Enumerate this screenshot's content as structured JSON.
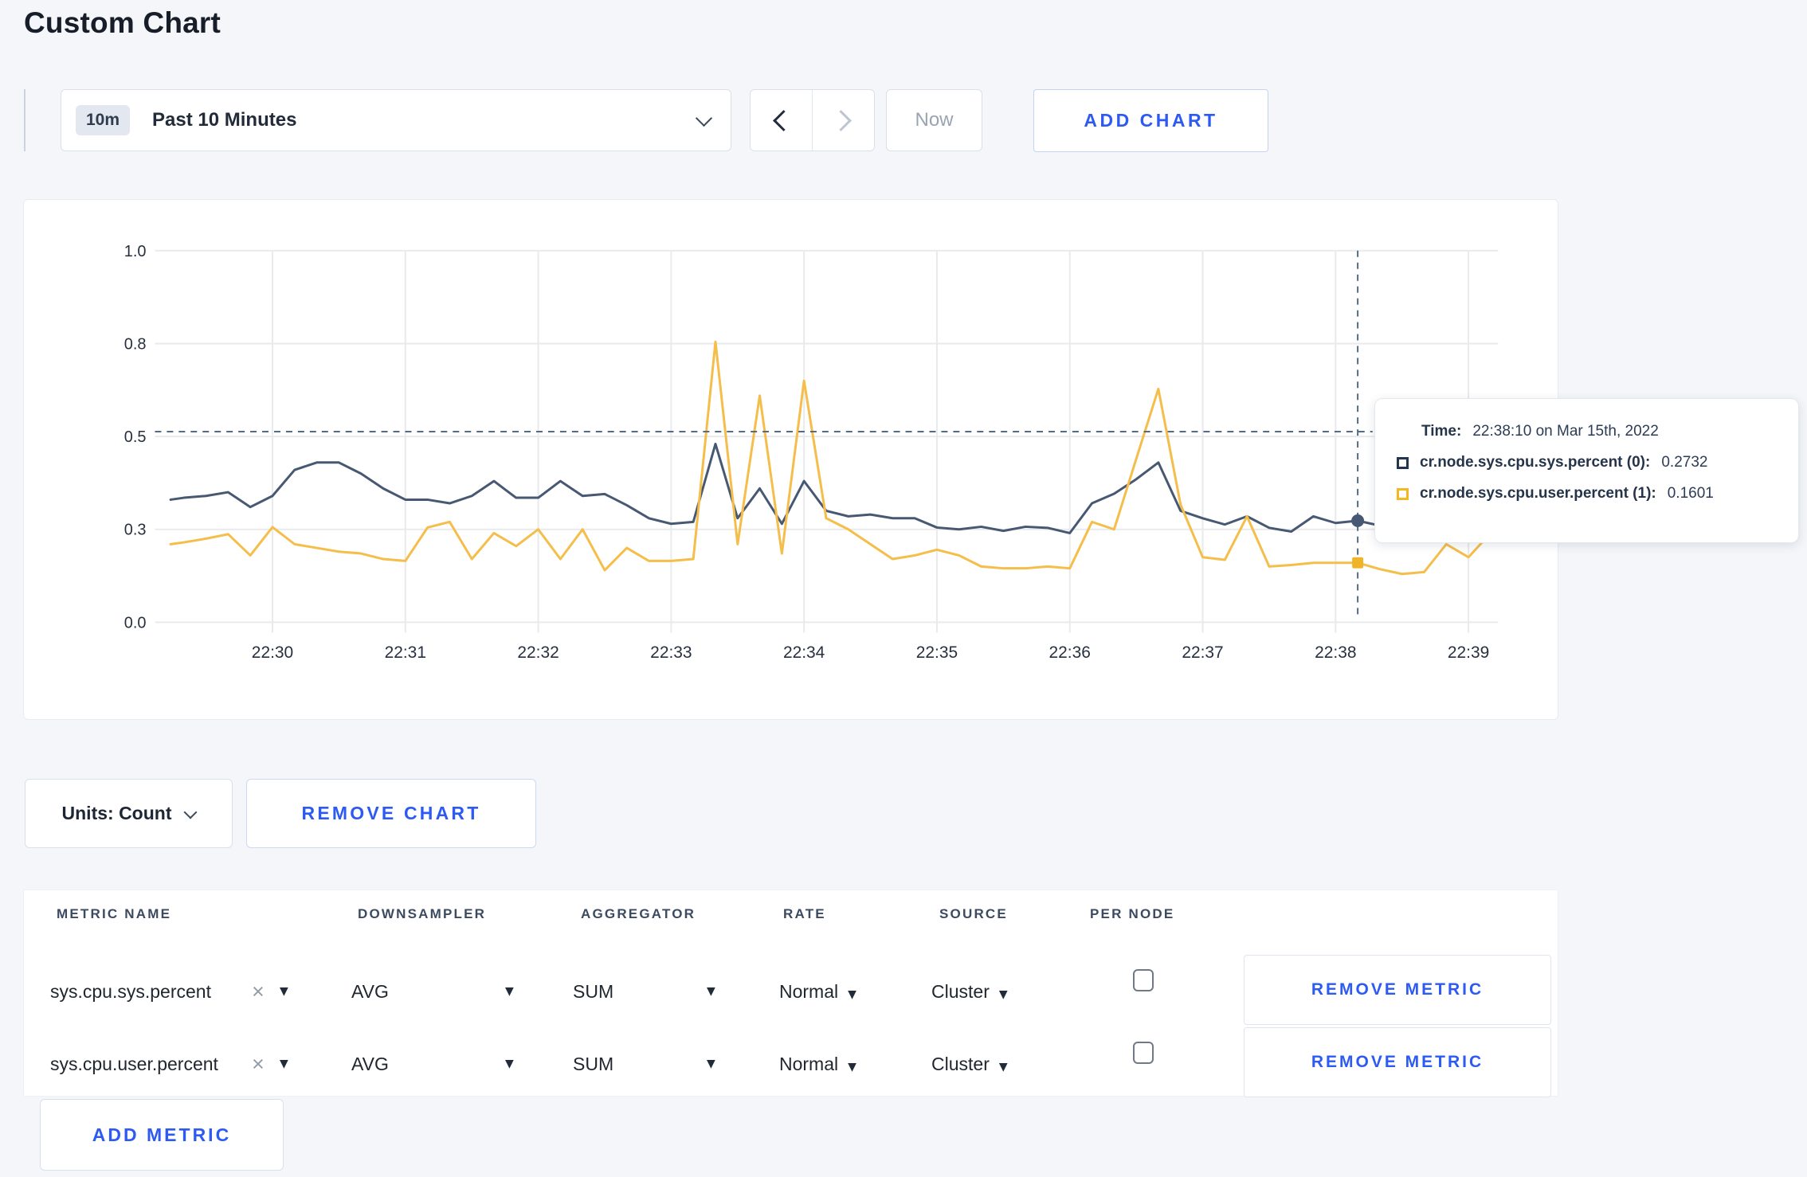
{
  "page": {
    "title": "Custom Chart"
  },
  "toolbar": {
    "range_badge": "10m",
    "range_label": "Past 10 Minutes",
    "now_label": "Now",
    "add_chart_label": "ADD CHART"
  },
  "chart_controls": {
    "units_label": "Units: Count",
    "remove_chart_label": "REMOVE CHART"
  },
  "tooltip": {
    "time_label": "Time:",
    "time_value": "22:38:10 on Mar 15th, 2022",
    "rows": [
      {
        "label": "cr.node.sys.cpu.sys.percent (0):",
        "value": "0.2732",
        "color": "#24344d"
      },
      {
        "label": "cr.node.sys.cpu.user.percent (1):",
        "value": "0.1601",
        "color": "#f3b822"
      }
    ]
  },
  "chart_data": {
    "type": "line",
    "title": "",
    "xlabel": "",
    "ylabel": "",
    "grid": true,
    "ylim": [
      0,
      1
    ],
    "y_tick_labels": [
      "1.0",
      "0.8",
      "0.5",
      "0.3",
      "0.0"
    ],
    "y_tick_values": [
      1.0,
      0.75,
      0.5,
      0.25,
      0.0
    ],
    "x_ticks": [
      "22:30",
      "22:31",
      "22:32",
      "22:33",
      "22:34",
      "22:35",
      "22:36",
      "22:37",
      "22:38",
      "22:39"
    ],
    "x_unit": "seconds after 22:29:00 on Mar 15th, 2022",
    "colors": {
      "grid": "#e9eaec",
      "axis_text": "#27303f",
      "crosshair": "#546b85"
    },
    "series": [
      {
        "name": "cr.node.sys.cpu.sys.percent",
        "color": "#475872",
        "points": [
          [
            14,
            0.33
          ],
          [
            20,
            0.335
          ],
          [
            30,
            0.34
          ],
          [
            40,
            0.35
          ],
          [
            50,
            0.31
          ],
          [
            60,
            0.34
          ],
          [
            70,
            0.41
          ],
          [
            80,
            0.43
          ],
          [
            90,
            0.43
          ],
          [
            100,
            0.4
          ],
          [
            110,
            0.36
          ],
          [
            120,
            0.33
          ],
          [
            130,
            0.33
          ],
          [
            140,
            0.32
          ],
          [
            150,
            0.34
          ],
          [
            160,
            0.38
          ],
          [
            170,
            0.335
          ],
          [
            180,
            0.335
          ],
          [
            190,
            0.38
          ],
          [
            200,
            0.34
          ],
          [
            210,
            0.345
          ],
          [
            220,
            0.315
          ],
          [
            230,
            0.28
          ],
          [
            240,
            0.265
          ],
          [
            250,
            0.27
          ],
          [
            260,
            0.48
          ],
          [
            270,
            0.28
          ],
          [
            280,
            0.36
          ],
          [
            290,
            0.265
          ],
          [
            300,
            0.38
          ],
          [
            310,
            0.3
          ],
          [
            320,
            0.285
          ],
          [
            330,
            0.29
          ],
          [
            340,
            0.28
          ],
          [
            350,
            0.28
          ],
          [
            360,
            0.255
          ],
          [
            370,
            0.25
          ],
          [
            380,
            0.257
          ],
          [
            390,
            0.246
          ],
          [
            400,
            0.257
          ],
          [
            410,
            0.254
          ],
          [
            420,
            0.24
          ],
          [
            430,
            0.32
          ],
          [
            440,
            0.346
          ],
          [
            450,
            0.385
          ],
          [
            460,
            0.43
          ],
          [
            470,
            0.3
          ],
          [
            480,
            0.28
          ],
          [
            490,
            0.263
          ],
          [
            500,
            0.285
          ],
          [
            510,
            0.254
          ],
          [
            520,
            0.244
          ],
          [
            530,
            0.285
          ],
          [
            540,
            0.267
          ],
          [
            550,
            0.2732
          ],
          [
            560,
            0.26
          ],
          [
            570,
            0.27
          ],
          [
            580,
            0.28
          ],
          [
            590,
            0.3
          ],
          [
            600,
            0.31
          ],
          [
            610,
            0.33
          ],
          [
            613,
            0.34
          ]
        ]
      },
      {
        "name": "cr.node.sys.cpu.user.percent",
        "color": "#f5bd49",
        "points": [
          [
            14,
            0.21
          ],
          [
            20,
            0.215
          ],
          [
            30,
            0.225
          ],
          [
            40,
            0.237
          ],
          [
            50,
            0.18
          ],
          [
            60,
            0.256
          ],
          [
            70,
            0.21
          ],
          [
            80,
            0.2
          ],
          [
            90,
            0.19
          ],
          [
            100,
            0.185
          ],
          [
            110,
            0.17
          ],
          [
            120,
            0.165
          ],
          [
            130,
            0.255
          ],
          [
            140,
            0.27
          ],
          [
            150,
            0.17
          ],
          [
            160,
            0.24
          ],
          [
            170,
            0.205
          ],
          [
            180,
            0.25
          ],
          [
            190,
            0.17
          ],
          [
            200,
            0.25
          ],
          [
            210,
            0.14
          ],
          [
            220,
            0.2
          ],
          [
            230,
            0.165
          ],
          [
            240,
            0.165
          ],
          [
            250,
            0.17
          ],
          [
            260,
            0.755
          ],
          [
            270,
            0.21
          ],
          [
            280,
            0.61
          ],
          [
            290,
            0.185
          ],
          [
            300,
            0.65
          ],
          [
            310,
            0.28
          ],
          [
            320,
            0.25
          ],
          [
            330,
            0.21
          ],
          [
            340,
            0.17
          ],
          [
            350,
            0.18
          ],
          [
            360,
            0.195
          ],
          [
            370,
            0.18
          ],
          [
            380,
            0.15
          ],
          [
            390,
            0.145
          ],
          [
            400,
            0.145
          ],
          [
            410,
            0.15
          ],
          [
            420,
            0.145
          ],
          [
            430,
            0.27
          ],
          [
            440,
            0.25
          ],
          [
            450,
            0.44
          ],
          [
            460,
            0.628
          ],
          [
            470,
            0.317
          ],
          [
            480,
            0.175
          ],
          [
            490,
            0.168
          ],
          [
            500,
            0.285
          ],
          [
            510,
            0.15
          ],
          [
            520,
            0.154
          ],
          [
            530,
            0.16
          ],
          [
            540,
            0.16
          ],
          [
            550,
            0.1601
          ],
          [
            560,
            0.143
          ],
          [
            570,
            0.13
          ],
          [
            580,
            0.135
          ],
          [
            590,
            0.21
          ],
          [
            600,
            0.175
          ],
          [
            610,
            0.24
          ],
          [
            613,
            0.27
          ]
        ]
      }
    ],
    "crosshair": {
      "time": "22:38:10",
      "x_sec": 550,
      "hline_value": 0.513,
      "sys_value": 0.2732,
      "user_value": 0.1601
    }
  },
  "metrics_table": {
    "headers": [
      "METRIC NAME",
      "DOWNSAMPLER",
      "AGGREGATOR",
      "RATE",
      "SOURCE",
      "PER NODE"
    ],
    "rows": [
      {
        "metric": "sys.cpu.sys.percent",
        "downsampler": "AVG",
        "aggregator": "SUM",
        "rate": "Normal",
        "source": "Cluster",
        "per_node_checked": false,
        "remove_label": "REMOVE METRIC"
      },
      {
        "metric": "sys.cpu.user.percent",
        "downsampler": "AVG",
        "aggregator": "SUM",
        "rate": "Normal",
        "source": "Cluster",
        "per_node_checked": false,
        "remove_label": "REMOVE METRIC"
      }
    ],
    "add_metric_label": "ADD METRIC"
  },
  "icons": {
    "close": "×",
    "caret": "▼"
  }
}
